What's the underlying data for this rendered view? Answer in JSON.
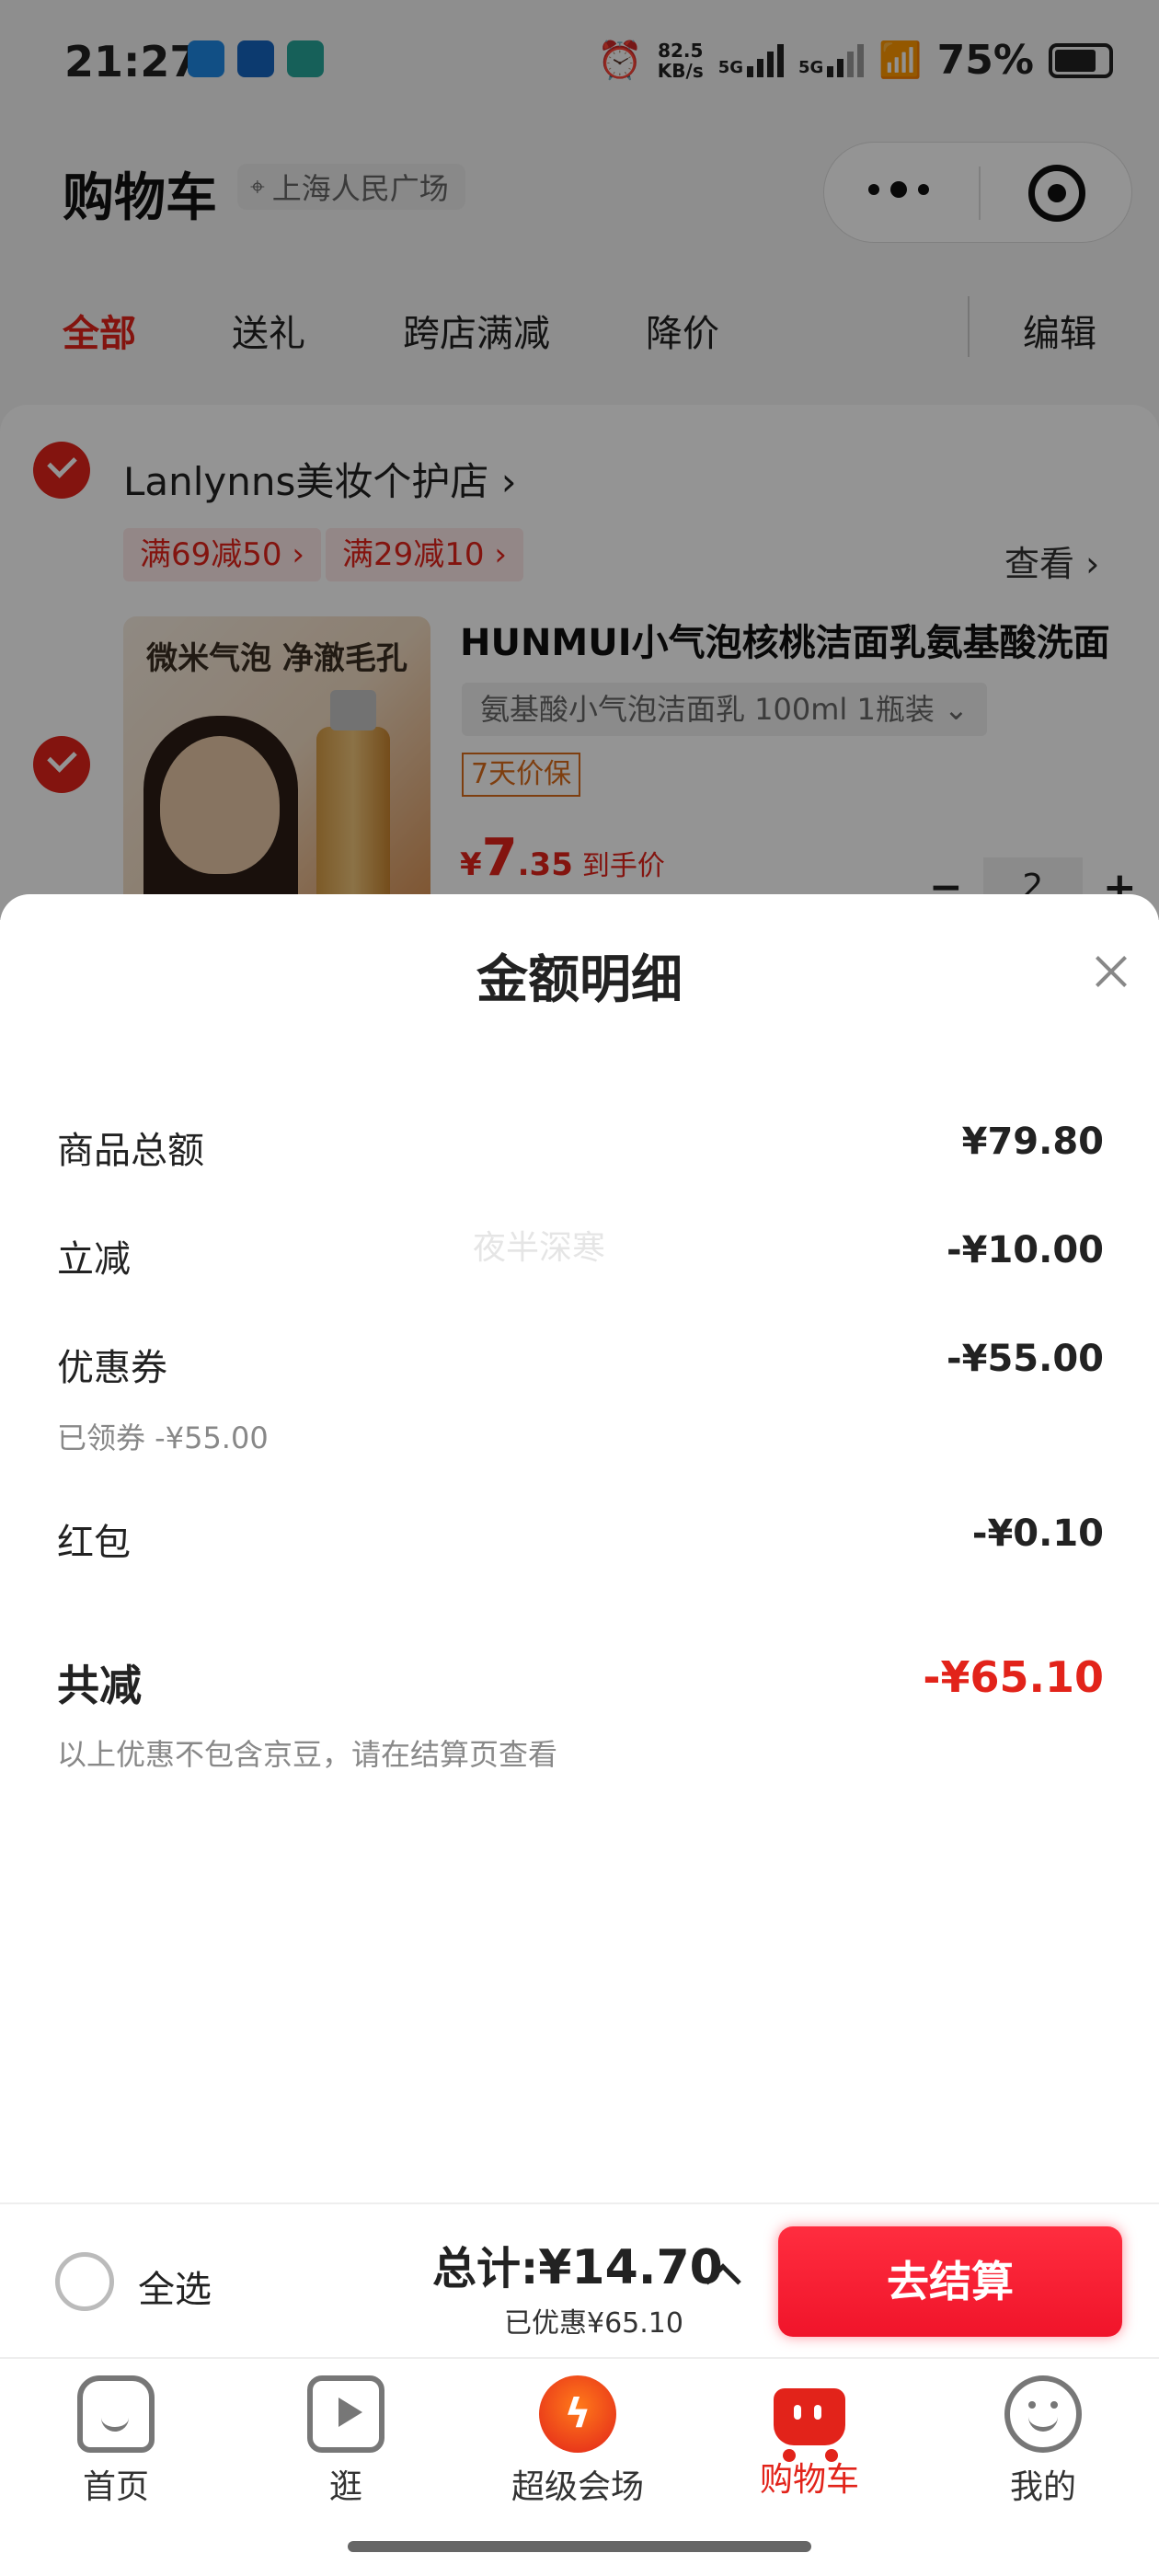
{
  "status_bar": {
    "time": "21:27",
    "net_speed_value": "82.5",
    "net_speed_unit": "KB/s",
    "sim1": "5G",
    "sim2": "5G",
    "battery": "75%"
  },
  "header": {
    "title": "购物车",
    "location": "上海人民广场"
  },
  "tabs": [
    {
      "label": "全部",
      "active": true
    },
    {
      "label": "送礼"
    },
    {
      "label": "跨店满减"
    },
    {
      "label": "降价"
    }
  ],
  "edit_label": "编辑",
  "store": {
    "name": "Lanlynns美妆个护店",
    "promos": [
      "满69减50",
      "满29减10"
    ],
    "see_more": "查看",
    "product": {
      "image_text": "微米气泡 净澈毛孔",
      "title": "HUNMUI小气泡核桃洁面乳氨基酸洗面",
      "spec": "氨基酸小气泡洁面乳 100ml 1瓶装",
      "guarantee": "7天价保",
      "price_symbol": "¥",
      "price_int": "7",
      "price_dec": ".35",
      "price_tip": "到手价",
      "quantity": "2"
    }
  },
  "sheet": {
    "title": "金额明细",
    "rows": [
      {
        "label": "商品总额",
        "value": "¥79.80"
      },
      {
        "label": "立减",
        "value": "-¥10.00"
      },
      {
        "label": "优惠券",
        "value": "-¥55.00",
        "note": "已领券 -¥55.00"
      },
      {
        "label": "红包",
        "value": "-¥0.10"
      }
    ],
    "total_label": "共减",
    "total_value": "-¥65.10",
    "footnote": "以上优惠不包含京豆，请在结算页查看",
    "watermark": "夜半深寒"
  },
  "checkout": {
    "select_all": "全选",
    "total_prefix": "总计:",
    "total_amount": "¥14.70",
    "saved": "已优惠¥65.10",
    "pay_button": "去结算"
  },
  "tabbar": [
    {
      "label": "首页",
      "icon": "home-icon"
    },
    {
      "label": "逛",
      "icon": "video-icon"
    },
    {
      "label": "超级会场",
      "icon": "super-venue-icon"
    },
    {
      "label": "购物车",
      "icon": "cart-icon",
      "active": true
    },
    {
      "label": "我的",
      "icon": "profile-icon"
    }
  ],
  "colors": {
    "accent": "#e2231a",
    "price_orange": "#d96b1b",
    "text": "#222222"
  }
}
